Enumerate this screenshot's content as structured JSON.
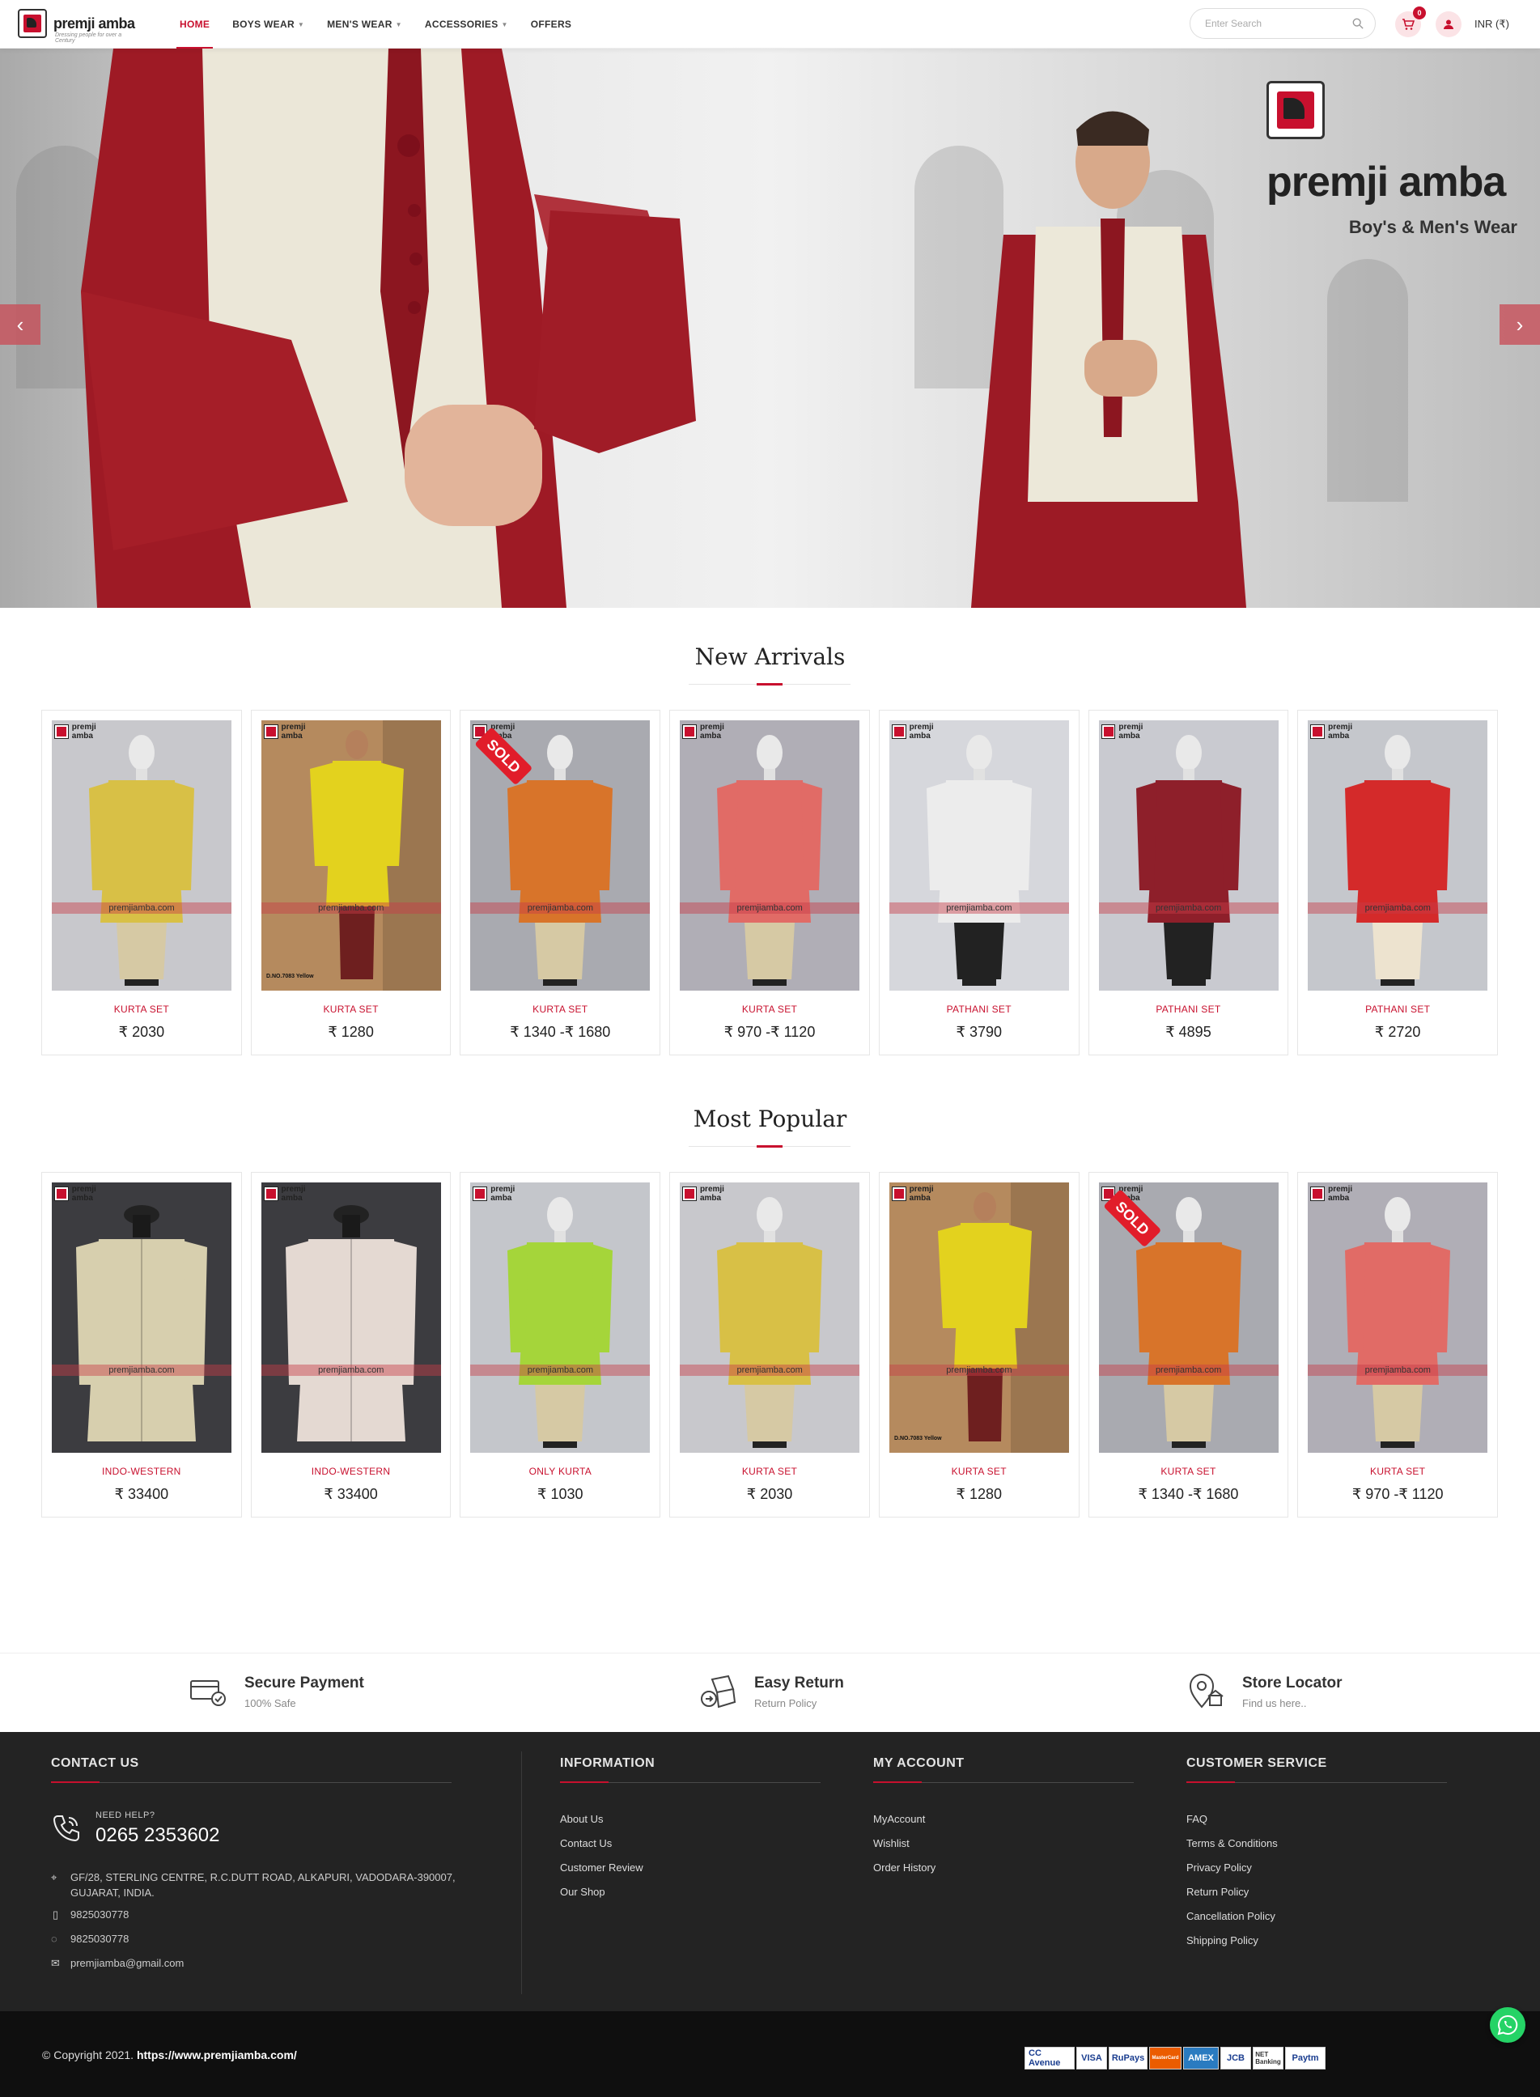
{
  "header": {
    "logo_text": "premji amba",
    "logo_tagline": "Dressing people for over a Century",
    "nav": [
      {
        "label": "HOME",
        "active": true,
        "dropdown": false
      },
      {
        "label": "BOYS WEAR",
        "active": false,
        "dropdown": true
      },
      {
        "label": "MEN'S WEAR",
        "active": false,
        "dropdown": true
      },
      {
        "label": "ACCESSORIES",
        "active": false,
        "dropdown": true
      },
      {
        "label": "OFFERS",
        "active": false,
        "dropdown": false
      }
    ],
    "search_placeholder": "Enter Search",
    "cart_count": "0",
    "currency": "INR (₹)"
  },
  "hero": {
    "brand": "premji amba",
    "tagline": "Boy's & Men's Wear"
  },
  "new_arrivals": {
    "title": "New Arrivals",
    "products": [
      {
        "category": "KURTA SET",
        "price": "₹ 2030",
        "sold": false,
        "color": "#d8c046",
        "bg": "#c8c8cc",
        "model": "mannequin"
      },
      {
        "category": "KURTA SET",
        "price": "₹ 1280",
        "sold": false,
        "color": "#e3d21e",
        "bg": "#b58a5e",
        "model": "person",
        "note": "D.NO.7083 Yellow"
      },
      {
        "category": "KURTA SET",
        "price": "₹ 1340 -₹ 1680",
        "sold": true,
        "color": "#d8742a",
        "bg": "#a9aab0",
        "model": "mannequin"
      },
      {
        "category": "KURTA SET",
        "price": "₹ 970 -₹ 1120",
        "sold": false,
        "color": "#e16b66",
        "bg": "#b0aeb6",
        "model": "mannequin"
      },
      {
        "category": "PATHANI SET",
        "price": "₹ 3790",
        "sold": false,
        "color": "#ececec",
        "bg": "#d6d7dc",
        "model": "mannequin",
        "bottom": "#222"
      },
      {
        "category": "PATHANI SET",
        "price": "₹ 4895",
        "sold": false,
        "color": "#8e1f2a",
        "bg": "#c9cad0",
        "model": "mannequin",
        "bottom": "#222"
      },
      {
        "category": "PATHANI SET",
        "price": "₹ 2720",
        "sold": false,
        "color": "#d42a2a",
        "bg": "#c5c7cc",
        "model": "mannequin",
        "bottom": "#ede3cf"
      }
    ]
  },
  "most_popular": {
    "title": "Most Popular",
    "products": [
      {
        "category": "INDO-WESTERN",
        "price": "₹ 33400",
        "sold": false,
        "color": "#d7cfae",
        "bg": "#3c3c40",
        "model": "jacket"
      },
      {
        "category": "INDO-WESTERN",
        "price": "₹ 33400",
        "sold": false,
        "color": "#e4d9d2",
        "bg": "#3c3c40",
        "model": "jacket"
      },
      {
        "category": "ONLY KURTA",
        "price": "₹ 1030",
        "sold": false,
        "color": "#a5d53a",
        "bg": "#c4c6cb",
        "model": "mannequin"
      },
      {
        "category": "KURTA SET",
        "price": "₹ 2030",
        "sold": false,
        "color": "#d8c046",
        "bg": "#c8c8cc",
        "model": "mannequin"
      },
      {
        "category": "KURTA SET",
        "price": "₹ 1280",
        "sold": false,
        "color": "#e3d21e",
        "bg": "#b58a5e",
        "model": "person",
        "note": "D.NO.7083 Yellow"
      },
      {
        "category": "KURTA SET",
        "price": "₹ 1340 -₹ 1680",
        "sold": true,
        "color": "#d8742a",
        "bg": "#a9aab0",
        "model": "mannequin"
      },
      {
        "category": "KURTA SET",
        "price": "₹ 970 -₹ 1120",
        "sold": false,
        "color": "#e16b66",
        "bg": "#b0aeb6",
        "model": "mannequin"
      }
    ]
  },
  "product_watermark": "premjiamba.com",
  "sold_label": "SOLD",
  "features": [
    {
      "title": "Secure Payment",
      "sub": "100% Safe",
      "icon": "secure-payment-icon"
    },
    {
      "title": "Easy Return",
      "sub": "Return Policy",
      "icon": "easy-return-icon"
    },
    {
      "title": "Store Locator",
      "sub": "Find us here..",
      "icon": "store-locator-icon"
    }
  ],
  "footer": {
    "contact": {
      "title": "CONTACT US",
      "need_help": "NEED HELP?",
      "phone": "0265 2353602",
      "address": "GF/28, STERLING CENTRE, R.C.DUTT ROAD, ALKAPURI, VADODARA-390007, GUJARAT, INDIA.",
      "mobile": "9825030778",
      "whatsapp": "9825030778",
      "email": "premjiamba@gmail.com"
    },
    "information": {
      "title": "INFORMATION",
      "links": [
        "About Us",
        "Contact Us",
        "Customer Review",
        "Our Shop"
      ]
    },
    "account": {
      "title": "MY ACCOUNT",
      "links": [
        "MyAccount",
        "Wishlist",
        "Order History"
      ]
    },
    "service": {
      "title": "CUSTOMER SERVICE",
      "links": [
        "FAQ",
        "Terms & Conditions",
        "Privacy Policy",
        "Return Policy",
        "Cancellation Policy",
        "Shipping Policy"
      ]
    }
  },
  "bottom": {
    "copyright_prefix": "© Copyright 2021.",
    "copyright_url": "https://www.premjiamba.com/",
    "payments": [
      "CC Avenue",
      "VISA",
      "RuPays",
      "MasterCard",
      "AMEX",
      "JCB",
      "NET Banking",
      "Paytm"
    ]
  },
  "colors": {
    "accent": "#c8102e",
    "footer_bg": "#232323",
    "bottom_bg": "#0f0f0f"
  }
}
